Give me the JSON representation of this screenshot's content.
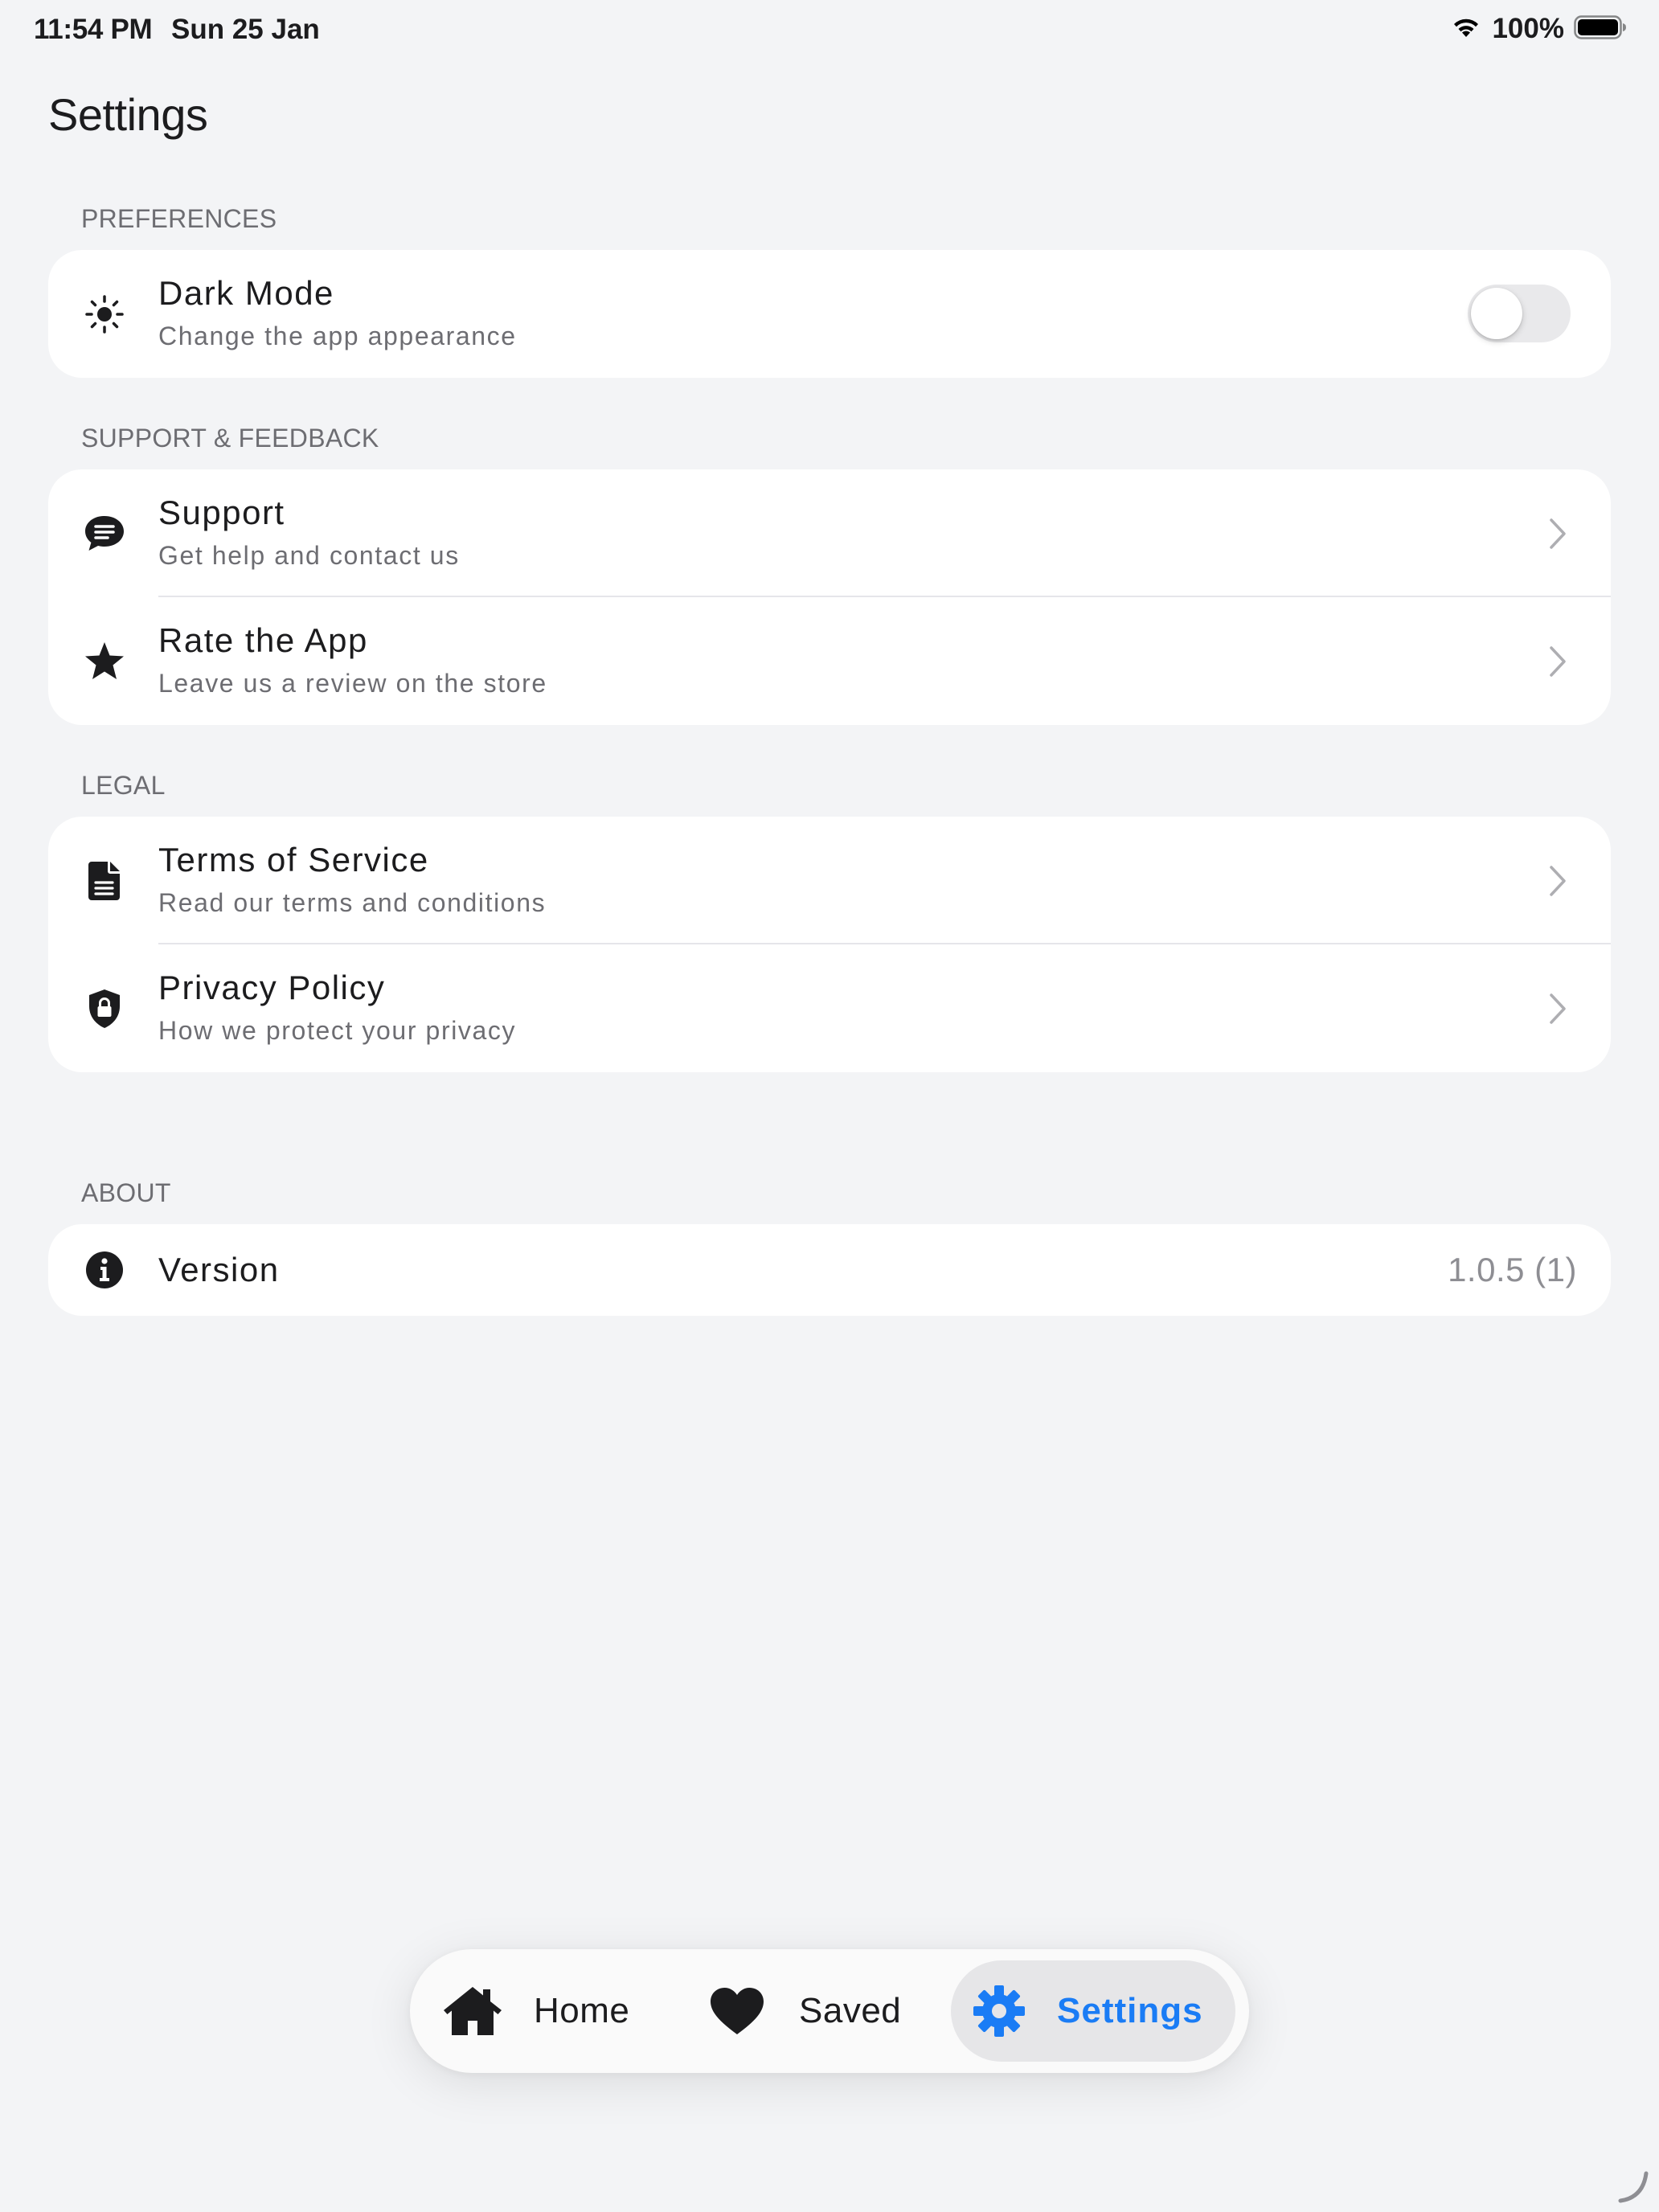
{
  "status_bar": {
    "time": "11:54 PM",
    "date": "Sun 25 Jan",
    "battery": "100%",
    "wifi_icon": "wifi-icon",
    "battery_icon": "battery-full-icon"
  },
  "page": {
    "title": "Settings"
  },
  "sections": {
    "preferences": {
      "header": "PREFERENCES",
      "dark_mode": {
        "icon": "sun-icon",
        "title": "Dark Mode",
        "subtitle": "Change the app appearance",
        "enabled": false
      }
    },
    "support": {
      "header": "SUPPORT & FEEDBACK",
      "items": [
        {
          "icon": "chat-bubble-icon",
          "title": "Support",
          "subtitle": "Get help and contact us"
        },
        {
          "icon": "star-icon",
          "title": "Rate the App",
          "subtitle": "Leave us a review on the store"
        }
      ]
    },
    "legal": {
      "header": "LEGAL",
      "items": [
        {
          "icon": "document-icon",
          "title": "Terms of Service",
          "subtitle": "Read our terms and conditions"
        },
        {
          "icon": "shield-lock-icon",
          "title": "Privacy Policy",
          "subtitle": "How we protect your privacy"
        }
      ]
    },
    "about": {
      "header": "ABOUT",
      "version": {
        "icon": "info-icon",
        "title": "Version",
        "value": "1.0.5 (1)"
      }
    }
  },
  "tab_bar": {
    "tabs": [
      {
        "label": "Home",
        "icon": "home-icon",
        "active": false
      },
      {
        "label": "Saved",
        "icon": "heart-icon",
        "active": false
      },
      {
        "label": "Settings",
        "icon": "gear-icon",
        "active": true
      }
    ]
  },
  "colors": {
    "accent": "#1a7cf5",
    "background": "#f3f4f6",
    "card": "#ffffff",
    "secondary_text": "#6d6d72"
  }
}
